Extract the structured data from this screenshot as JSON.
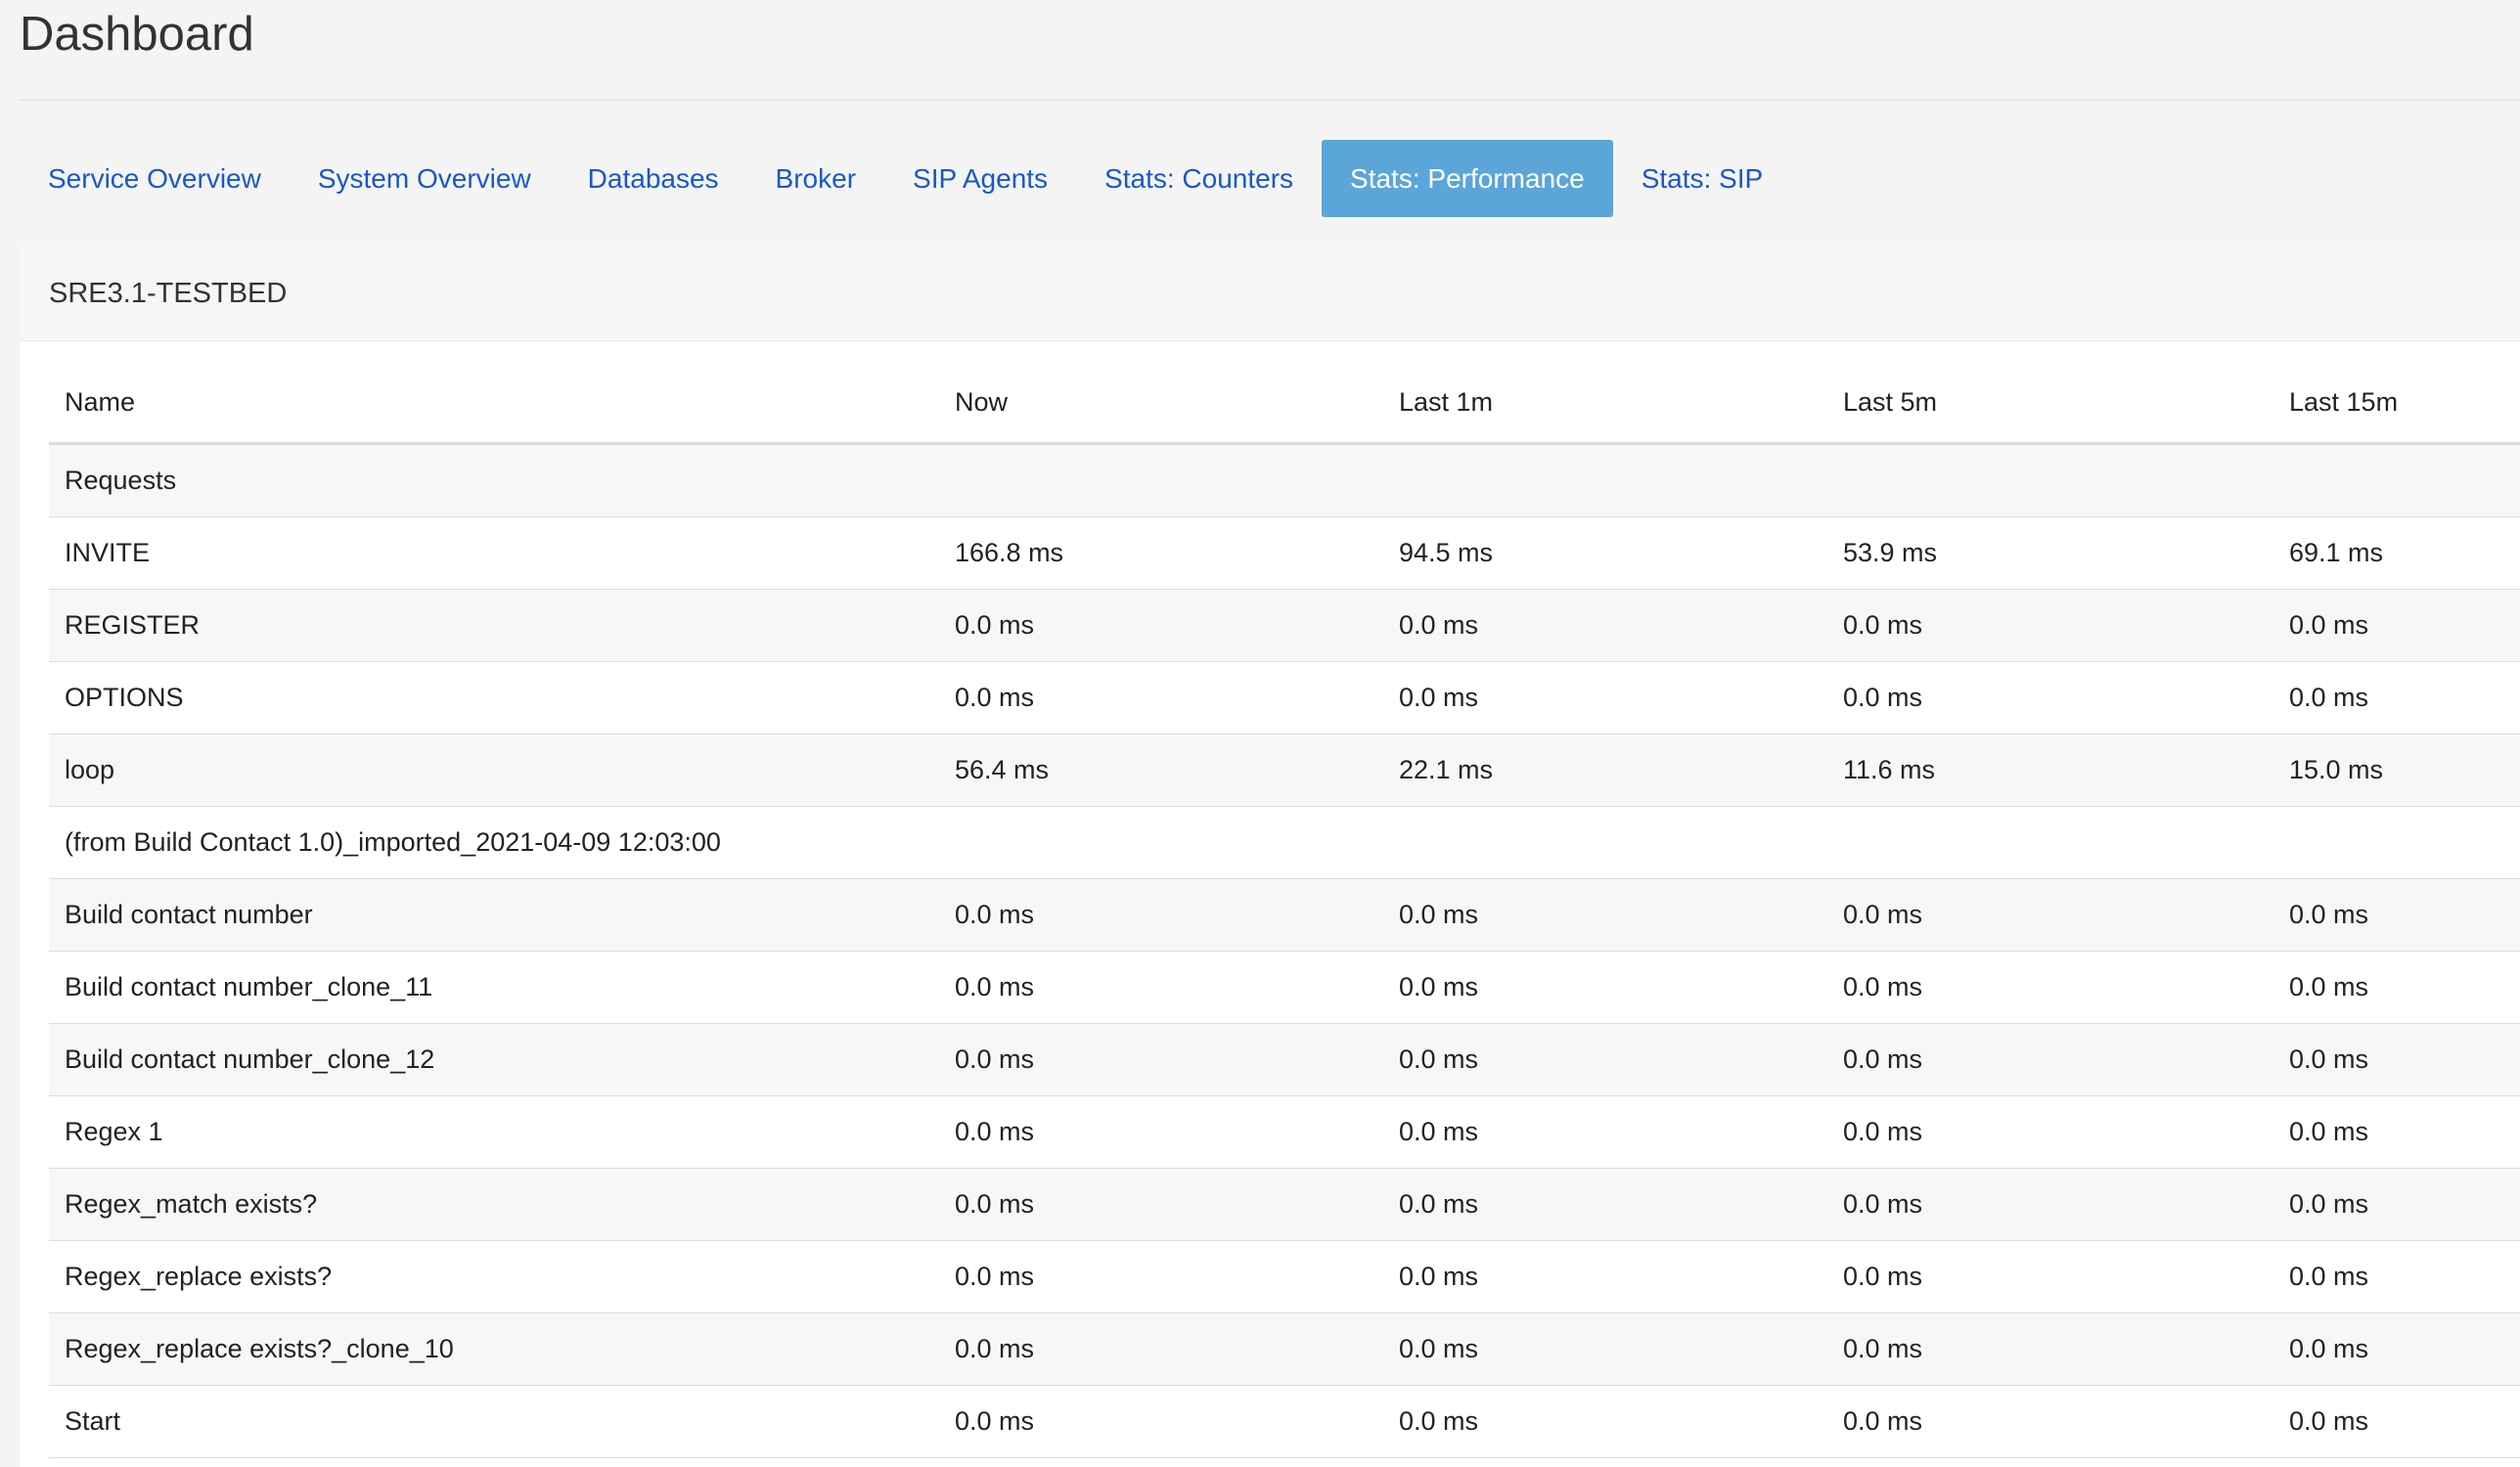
{
  "page": {
    "title": "Dashboard"
  },
  "tabs": [
    {
      "label": "Service Overview",
      "active": false
    },
    {
      "label": "System Overview",
      "active": false
    },
    {
      "label": "Databases",
      "active": false
    },
    {
      "label": "Broker",
      "active": false
    },
    {
      "label": "SIP Agents",
      "active": false
    },
    {
      "label": "Stats: Counters",
      "active": false
    },
    {
      "label": "Stats: Performance",
      "active": true
    },
    {
      "label": "Stats: SIP",
      "active": false
    }
  ],
  "panel": {
    "title": "SRE3.1-TESTBED"
  },
  "table": {
    "columns": [
      "Name",
      "Now",
      "Last 1m",
      "Last 5m",
      "Last 15m"
    ],
    "rows": [
      {
        "name": "Requests",
        "now": "",
        "last_1m": "",
        "last_5m": "",
        "last_15m": ""
      },
      {
        "name": "INVITE",
        "now": "166.8 ms",
        "last_1m": "94.5 ms",
        "last_5m": "53.9 ms",
        "last_15m": "69.1 ms"
      },
      {
        "name": "REGISTER",
        "now": "0.0 ms",
        "last_1m": "0.0 ms",
        "last_5m": "0.0 ms",
        "last_15m": "0.0 ms"
      },
      {
        "name": "OPTIONS",
        "now": "0.0 ms",
        "last_1m": "0.0 ms",
        "last_5m": "0.0 ms",
        "last_15m": "0.0 ms"
      },
      {
        "name": "loop",
        "now": "56.4 ms",
        "last_1m": "22.1 ms",
        "last_5m": "11.6 ms",
        "last_15m": "15.0 ms"
      },
      {
        "name": "(from Build Contact 1.0)_imported_2021-04-09 12:03:00",
        "now": "",
        "last_1m": "",
        "last_5m": "",
        "last_15m": ""
      },
      {
        "name": "Build contact number",
        "now": "0.0 ms",
        "last_1m": "0.0 ms",
        "last_5m": "0.0 ms",
        "last_15m": "0.0 ms"
      },
      {
        "name": "Build contact number_clone_11",
        "now": "0.0 ms",
        "last_1m": "0.0 ms",
        "last_5m": "0.0 ms",
        "last_15m": "0.0 ms"
      },
      {
        "name": "Build contact number_clone_12",
        "now": "0.0 ms",
        "last_1m": "0.0 ms",
        "last_5m": "0.0 ms",
        "last_15m": "0.0 ms"
      },
      {
        "name": "Regex 1",
        "now": "0.0 ms",
        "last_1m": "0.0 ms",
        "last_5m": "0.0 ms",
        "last_15m": "0.0 ms"
      },
      {
        "name": "Regex_match exists?",
        "now": "0.0 ms",
        "last_1m": "0.0 ms",
        "last_5m": "0.0 ms",
        "last_15m": "0.0 ms"
      },
      {
        "name": "Regex_replace exists?",
        "now": "0.0 ms",
        "last_1m": "0.0 ms",
        "last_5m": "0.0 ms",
        "last_15m": "0.0 ms"
      },
      {
        "name": "Regex_replace exists?_clone_10",
        "now": "0.0 ms",
        "last_1m": "0.0 ms",
        "last_5m": "0.0 ms",
        "last_15m": "0.0 ms"
      },
      {
        "name": "Start",
        "now": "0.0 ms",
        "last_1m": "0.0 ms",
        "last_5m": "0.0 ms",
        "last_15m": "0.0 ms"
      }
    ]
  },
  "colors": {
    "page_background": "#f4f4f4",
    "tab_link": "#1a58c8",
    "tab_active_background": "#5ba5d8",
    "tab_active_text": "#ffffff",
    "row_stripe": "#f7f7f7",
    "row_border": "#dcdcdc"
  }
}
